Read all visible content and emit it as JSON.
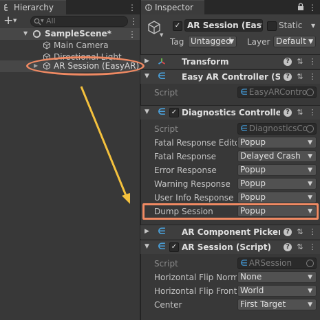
{
  "hierarchy": {
    "tab_title": "Hierarchy",
    "add_glyph": "+",
    "search_placeholder": "All",
    "scene_name": "SampleScene*",
    "items": [
      {
        "label": "Main Camera"
      },
      {
        "label": "Directional Light"
      },
      {
        "label": "AR Session (EasyAR)"
      }
    ]
  },
  "inspector": {
    "tab_title": "Inspector",
    "object_name": "AR Session (EasyA",
    "object_active": true,
    "static_label": "Static",
    "tag_label": "Tag",
    "tag_value": "Untagged",
    "layer_label": "Layer",
    "layer_value": "Default",
    "components": {
      "transform": {
        "title": "Transform"
      },
      "easyar_controller": {
        "title": "Easy AR Controller (Sc",
        "script_label": "Script",
        "script_value": "EasyARContro"
      },
      "diagnostics": {
        "title": "Diagnostics Controller",
        "enabled": true,
        "script_label": "Script",
        "script_value": "DiagnosticsCo",
        "fields": [
          {
            "label": "Fatal Response Editor",
            "value": "Popup"
          },
          {
            "label": "Fatal Response",
            "value": "Delayed Crash"
          },
          {
            "label": "Error Response",
            "value": "Popup"
          },
          {
            "label": "Warning Response",
            "value": "Popup"
          },
          {
            "label": "User Info Response",
            "value": "Popup"
          },
          {
            "label": "Dump Session",
            "value": "Popup"
          }
        ]
      },
      "ar_component_picker": {
        "title": "AR Component Picker ("
      },
      "ar_session": {
        "title": "AR Session (Script)",
        "enabled": true,
        "script_label": "Script",
        "script_value": "ARSession",
        "fields": [
          {
            "label": "Horizontal Flip Norma",
            "value": "None"
          },
          {
            "label": "Horizontal Flip Front",
            "value": "World"
          },
          {
            "label": "Center",
            "value": "First Target"
          }
        ]
      }
    }
  },
  "annotation": {
    "highlight_color": "#f08a63",
    "arrow_color": "#f4c13d"
  },
  "icons": [
    "hierarchy-icon",
    "add-icon",
    "search-icon",
    "scene-icon",
    "gameobject-icon",
    "info-icon",
    "transform-icon",
    "script-icon",
    "help-icon",
    "settings-icon",
    "more-icon",
    "caret-down-icon",
    "lock-icon",
    "object-target-icon"
  ],
  "glyphs": {
    "check": "✓",
    "caret": "▼",
    "help": "?",
    "settings": "⇅",
    "more": "⋮",
    "script": "∈"
  }
}
